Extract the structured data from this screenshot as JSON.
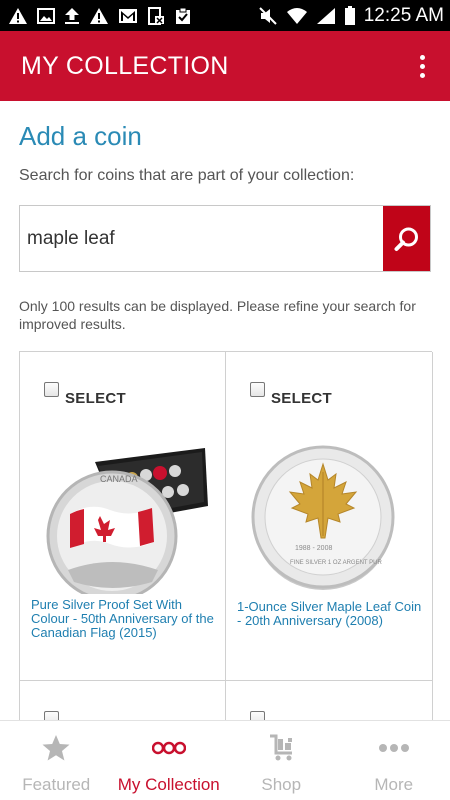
{
  "status_bar": {
    "time": "12:25 AM",
    "left_icons": [
      "warning-icon",
      "image-icon",
      "upload-icon",
      "warning-icon",
      "gmail-icon",
      "sim-card-icon",
      "clipboard-check-icon"
    ],
    "right_icons": [
      "mute-icon",
      "wifi-icon",
      "signal-icon",
      "battery-icon"
    ]
  },
  "app_bar": {
    "title": "MY COLLECTION",
    "background": "#c8102e"
  },
  "main": {
    "title": "Add a coin",
    "instructions": "Search for coins that are part of your collection:",
    "search": {
      "value": "maple leaf",
      "button_icon": "search-icon",
      "button_color": "#c00418"
    },
    "notice": "Only 100 results can be displayed. Please refine your search for improved results.",
    "results": [
      {
        "select_label": "SELECT",
        "checked": false,
        "name": "Pure Silver Proof Set With Colour - 50th Anniversary of the Canadian Flag (2015)"
      },
      {
        "select_label": "SELECT",
        "checked": false,
        "name": "1-Ounce Silver Maple Leaf Coin - 20th Anniversary (2008)"
      },
      {
        "select_label": "",
        "checked": false,
        "name": ""
      },
      {
        "select_label": "",
        "checked": false,
        "name": ""
      }
    ]
  },
  "bottom_nav": {
    "items": [
      {
        "label": "Featured",
        "icon": "star-icon",
        "active": false
      },
      {
        "label": "My Collection",
        "icon": "coins-icon",
        "active": true
      },
      {
        "label": "Shop",
        "icon": "cart-icon",
        "active": false
      },
      {
        "label": "More",
        "icon": "more-dots-icon",
        "active": false
      }
    ],
    "active_color": "#c8102e",
    "inactive_color": "#b6b6b6"
  }
}
